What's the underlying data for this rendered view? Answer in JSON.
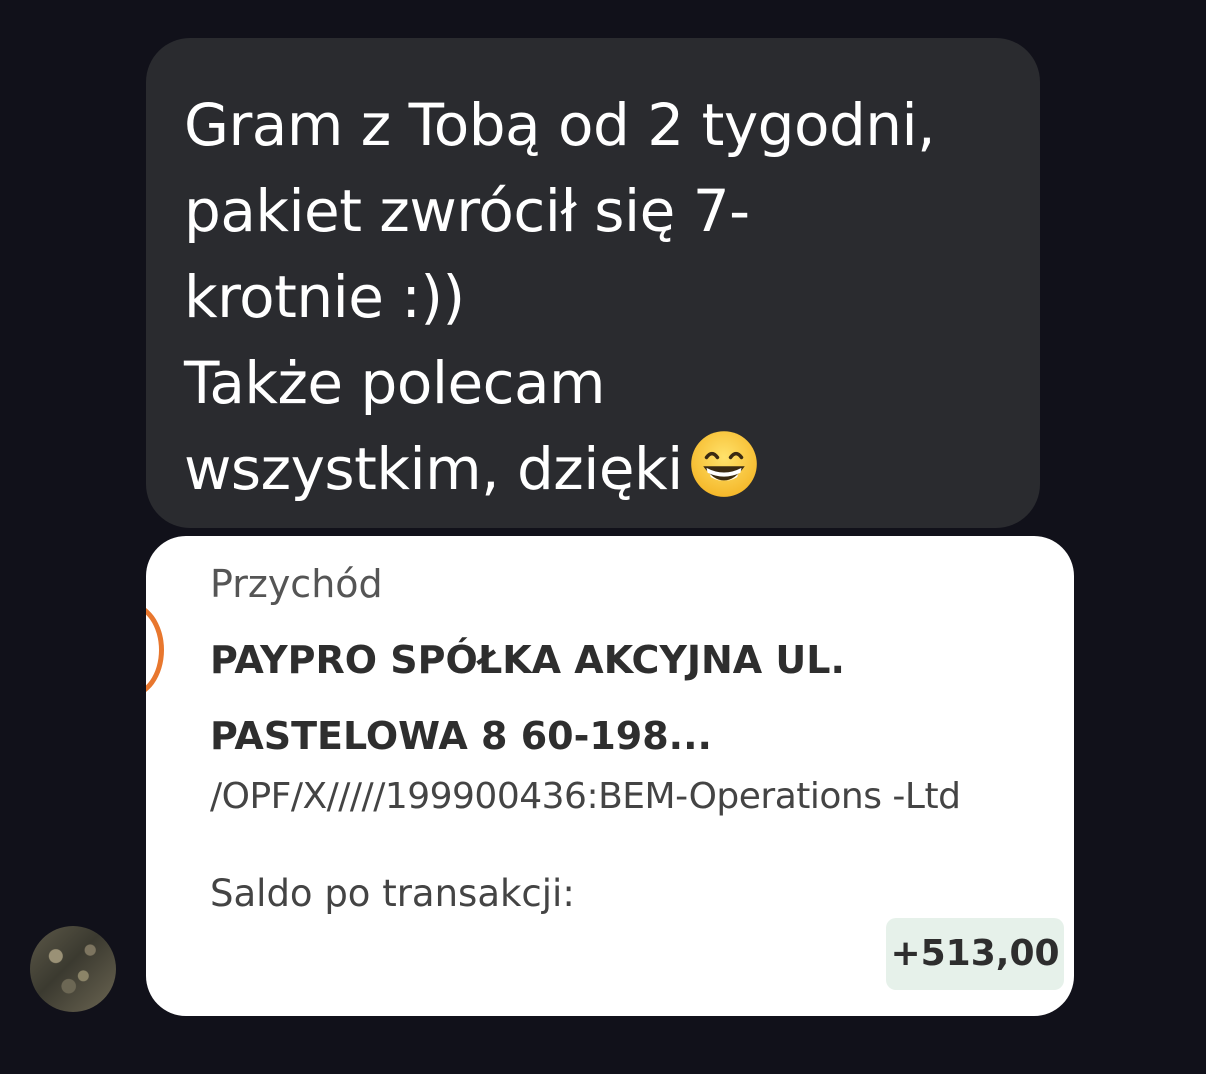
{
  "message": {
    "lines": [
      "Gram z Tobą od 2 tygodni,",
      "pakiet zwrócił się 7-",
      "krotnie :))",
      "Także polecam",
      "wszystkim, dzięki"
    ],
    "emoji": "grinning-face-with-smiling-eyes"
  },
  "transaction": {
    "type": "Przychód",
    "payee_line1": "PAYPRO SPÓŁKA AKCYJNA UL.",
    "payee_line2": "PASTELOWA 8 60-198...",
    "reference": "/OPF/X/////199900436:BEM-Operations -Ltd",
    "balance_label": "Saldo po transakcji:",
    "amount": "+513,00"
  },
  "colors": {
    "background": "#11111a",
    "dark_bubble": "#2a2b2f",
    "light_bubble": "#ffffff",
    "accent_arc": "#e8772e",
    "amount_chip": "#e6f1ea"
  }
}
